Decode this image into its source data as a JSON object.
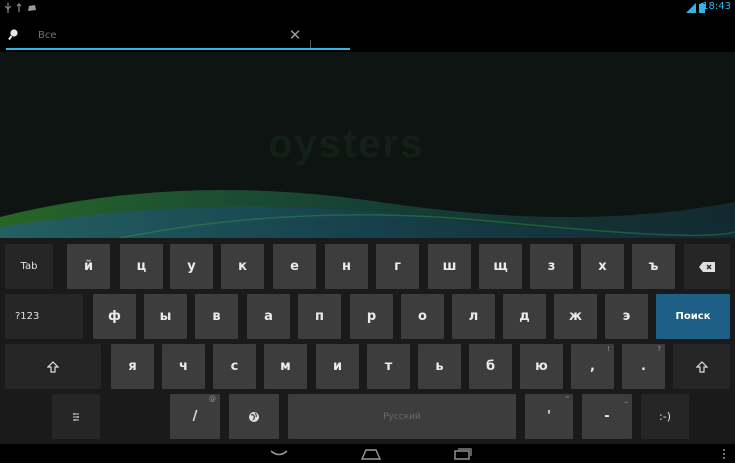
{
  "status_bar": {
    "time": "18:43",
    "left_icons": [
      "usb-icon",
      "wifi-sync-icon",
      "notification-icon"
    ],
    "right_icons": [
      "signal-icon",
      "battery-icon"
    ],
    "accent": "#33b5e5"
  },
  "search": {
    "placeholder": "Все",
    "value": "",
    "underline_color": "#33b5e5"
  },
  "wallpaper": {
    "text": "oysters"
  },
  "keyboard": {
    "row1": {
      "tab": "Tab",
      "letters": [
        "й",
        "ц",
        "у",
        "к",
        "е",
        "н",
        "г",
        "ш",
        "щ",
        "з",
        "х",
        "ъ"
      ],
      "backspace": "backspace-icon"
    },
    "row2": {
      "symbols": "?123",
      "letters": [
        "ф",
        "ы",
        "в",
        "а",
        "п",
        "р",
        "о",
        "л",
        "д",
        "ж",
        "э"
      ],
      "action": "Поиск",
      "action_color": "#1d5f86"
    },
    "row3": {
      "shift_left": "shift-icon",
      "letters": [
        "я",
        "ч",
        "с",
        "м",
        "и",
        "т",
        "ь",
        "б",
        "ю"
      ],
      "comma": ",",
      "comma_hint": "!",
      "period": ".",
      "period_hint": "?",
      "shift_right": "shift-icon"
    },
    "row4": {
      "settings": "settings-icon",
      "slash": "/",
      "slash_hint": "@",
      "globe": "globe-icon",
      "space_label": "Русский",
      "apostrophe": "'",
      "apostrophe_hint": "\"",
      "dash": "-",
      "dash_hint": "_",
      "smiley": ":-)"
    }
  },
  "nav_bar": {
    "buttons": [
      "hide-keyboard-icon",
      "home-icon",
      "recent-apps-icon",
      "menu-icon"
    ]
  }
}
